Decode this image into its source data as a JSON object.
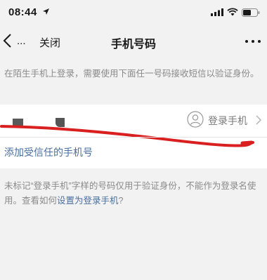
{
  "status_bar": {
    "time": "08:44",
    "icons": [
      "location-arrow-icon",
      "signal-icon",
      "wifi-icon",
      "battery-icon"
    ]
  },
  "nav": {
    "back_ellipsis": "...",
    "close_label": "关闭",
    "title": "手机号码",
    "more_icon": "more-icon"
  },
  "description": "在陌生手机上登录，需要使用下面任一号码接收短信以验证身份。",
  "phone_list": {
    "login_label": "登录手机",
    "add_trusted_label": "添加受信任的手机号"
  },
  "note": {
    "text": "未标记“登录手机”字样的号码仅用于验证身份，不能作为登录名使用。查看如何",
    "link_text": "设置为登录手机",
    "suffix": "?"
  },
  "colors": {
    "background": "#f2f2f2",
    "card": "#ffffff",
    "link": "#4a6fa0",
    "secondary_text": "#8a8a8a",
    "redaction_scribble": "#d91f1f"
  }
}
